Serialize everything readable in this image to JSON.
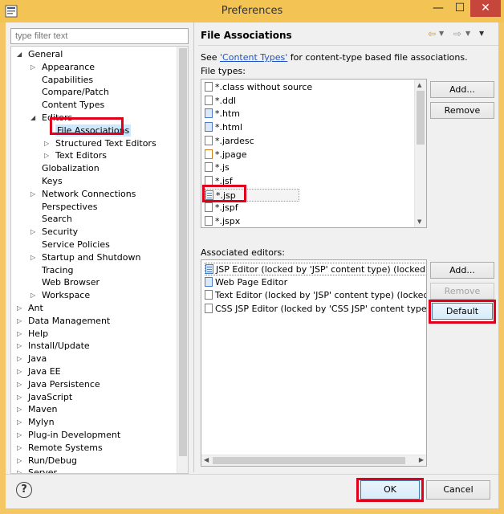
{
  "window": {
    "title": "Preferences",
    "minimize": "—",
    "maximize": "☐",
    "close": "✕"
  },
  "filter": {
    "placeholder": "type filter text"
  },
  "tree": {
    "items": [
      {
        "label": "General",
        "state": "expanded"
      },
      {
        "label": "Appearance",
        "state": "collapsed"
      },
      {
        "label": "Capabilities"
      },
      {
        "label": "Compare/Patch"
      },
      {
        "label": "Content Types"
      },
      {
        "label": "Editors",
        "state": "expanded"
      },
      {
        "label": "File Associations",
        "selected": true
      },
      {
        "label": "Structured Text Editors",
        "state": "collapsed"
      },
      {
        "label": "Text Editors",
        "state": "collapsed"
      },
      {
        "label": "Globalization"
      },
      {
        "label": "Keys"
      },
      {
        "label": "Network Connections",
        "state": "collapsed"
      },
      {
        "label": "Perspectives"
      },
      {
        "label": "Search"
      },
      {
        "label": "Security",
        "state": "collapsed"
      },
      {
        "label": "Service Policies"
      },
      {
        "label": "Startup and Shutdown",
        "state": "collapsed"
      },
      {
        "label": "Tracing"
      },
      {
        "label": "Web Browser"
      },
      {
        "label": "Workspace",
        "state": "collapsed"
      },
      {
        "label": "Ant",
        "state": "collapsed"
      },
      {
        "label": "Data Management",
        "state": "collapsed"
      },
      {
        "label": "Help",
        "state": "collapsed"
      },
      {
        "label": "Install/Update",
        "state": "collapsed"
      },
      {
        "label": "Java",
        "state": "collapsed"
      },
      {
        "label": "Java EE",
        "state": "collapsed"
      },
      {
        "label": "Java Persistence",
        "state": "collapsed"
      },
      {
        "label": "JavaScript",
        "state": "collapsed"
      },
      {
        "label": "Maven",
        "state": "collapsed"
      },
      {
        "label": "Mylyn",
        "state": "collapsed"
      },
      {
        "label": "Plug-in Development",
        "state": "collapsed"
      },
      {
        "label": "Remote Systems",
        "state": "collapsed"
      },
      {
        "label": "Run/Debug",
        "state": "collapsed"
      },
      {
        "label": "Server",
        "state": "collapsed"
      }
    ]
  },
  "page": {
    "title": "File Associations",
    "description_prefix": "See ",
    "description_link": "'Content Types'",
    "description_suffix": " for content-type based file associations.",
    "file_types_label": "File types:",
    "file_types": [
      {
        "label": "*.class without source",
        "icon": "class-file-icon"
      },
      {
        "label": "*.ddl",
        "icon": "ddl-file-icon"
      },
      {
        "label": "*.htm",
        "icon": "web-file-icon"
      },
      {
        "label": "*.html",
        "icon": "web-file-icon"
      },
      {
        "label": "*.jardesc",
        "icon": "jardesc-file-icon"
      },
      {
        "label": "*.jpage",
        "icon": "java-file-icon"
      },
      {
        "label": "*.js",
        "icon": "js-file-icon"
      },
      {
        "label": "*.jsf",
        "icon": "text-file-icon"
      },
      {
        "label": "*.jsp",
        "icon": "jsp-file-icon",
        "selected": true
      },
      {
        "label": "*.jspf",
        "icon": "text-file-icon"
      },
      {
        "label": "*.jspx",
        "icon": "text-file-icon"
      }
    ],
    "file_types_add": "Add...",
    "file_types_remove": "Remove",
    "editors_label": "Associated editors:",
    "editors": [
      {
        "label": "JSP Editor (locked by 'JSP' content type) (locked by 'CSS",
        "icon": "jsp-editor-icon"
      },
      {
        "label": "Web Page Editor",
        "icon": "web-page-editor-icon"
      },
      {
        "label": "Text Editor (locked by 'JSP' content type) (locked by 'CS",
        "icon": "text-editor-icon"
      },
      {
        "label": "CSS JSP Editor (locked by 'CSS JSP' content type)",
        "icon": "css-editor-icon"
      }
    ],
    "editors_add": "Add...",
    "editors_remove": "Remove",
    "editors_default": "Default"
  },
  "footer": {
    "help": "?",
    "ok": "OK",
    "cancel": "Cancel"
  }
}
